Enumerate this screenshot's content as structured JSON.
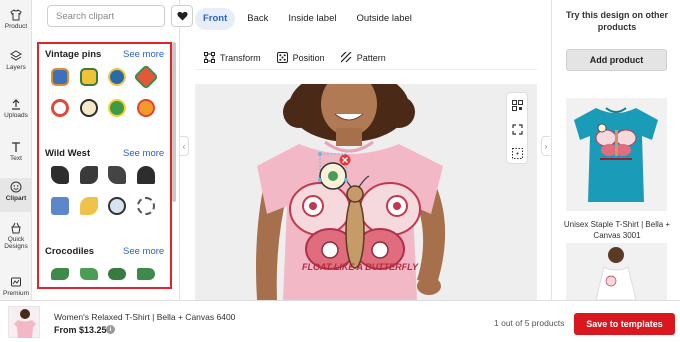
{
  "rail": {
    "items": [
      {
        "label": "Product",
        "icon": "shirt-icon"
      },
      {
        "label": "Layers",
        "icon": "layers-icon"
      },
      {
        "label": "Uploads",
        "icon": "upload-icon"
      },
      {
        "label": "Text",
        "icon": "text-icon"
      },
      {
        "label": "Clipart",
        "icon": "smiley-icon",
        "active": true
      },
      {
        "label": "Quick Designs",
        "icon": "bucket-icon"
      },
      {
        "label": "Premium",
        "icon": "premium-icon"
      }
    ]
  },
  "clipart": {
    "search_placeholder": "Search clipart",
    "sections": [
      {
        "title": "Vintage pins",
        "see_more": "See more"
      },
      {
        "title": "Wild West",
        "see_more": "See more"
      },
      {
        "title": "Crocodiles",
        "see_more": "See more"
      }
    ]
  },
  "editor": {
    "tabs": [
      "Front",
      "Back",
      "Inside label",
      "Outside label"
    ],
    "active_tab": "Front",
    "tools": [
      "Transform",
      "Position",
      "Pattern"
    ],
    "design_text": "FLOAT LIKE A BUTTERFLY",
    "badge_text": "GOOD LUCK"
  },
  "right_panel": {
    "title": "Try this design on other products",
    "add_button": "Add product",
    "product_caption": "Unisex Staple T-Shirt | Bella + Canvas 3001"
  },
  "bottom_bar": {
    "product_name": "Women's Relaxed T-Shirt | Bella + Canvas 6400",
    "price": "From $13.25",
    "count": "1 out of 5 products",
    "save_button": "Save to templates"
  },
  "colors": {
    "accent": "#2a62c9",
    "save": "#d9171e",
    "highlight": "#e0242a",
    "shirt_pink": "#f2b8c6",
    "shirt_teal": "#1a9bb8"
  }
}
